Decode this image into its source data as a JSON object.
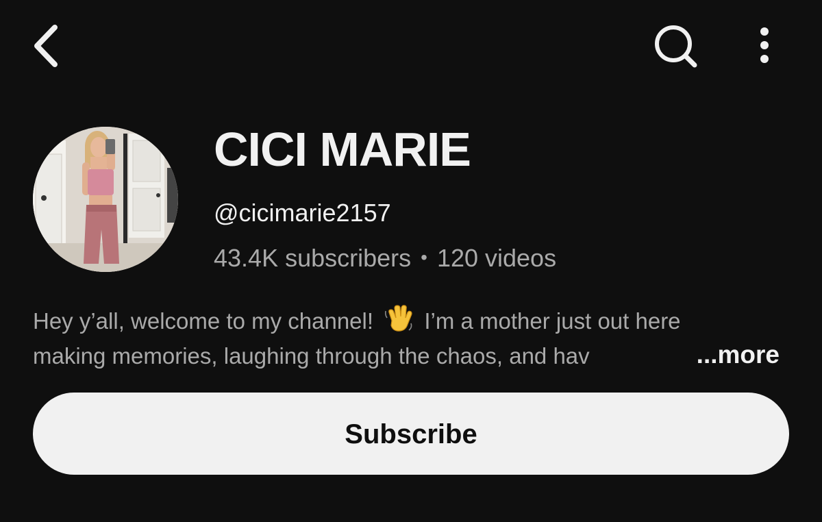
{
  "header": {
    "back_icon": "chevron-left-icon",
    "search_icon": "search-icon",
    "more_icon": "more-vertical-icon"
  },
  "channel": {
    "name": "CICI MARIE",
    "handle": "@cicimarie2157",
    "subscribers": "43.4K subscribers",
    "separator": "•",
    "videos": "120 videos",
    "description_line1": "Hey y’all, welcome to my channel! ",
    "description_line1_b": " I’m a mother just out here",
    "description_line2": "making memories, laughing through the chaos, and hav",
    "more_label": "...more"
  },
  "actions": {
    "subscribe_label": "Subscribe"
  },
  "colors": {
    "background": "#0f0f0f",
    "primary_text": "#f1f1f1",
    "secondary_text": "#aaaaaa",
    "button_bg": "#f1f1f1"
  }
}
